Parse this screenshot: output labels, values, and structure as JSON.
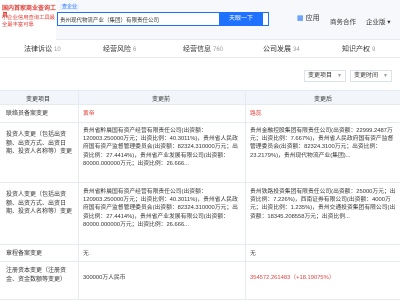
{
  "header": {
    "logo_line1": "国内首家商业查询工具",
    "logo_line2": "小企业信用查询工具最全最丰富可靠",
    "search_value": "贵州现代物流产业（集团）有限责任公司",
    "search_tag": "查企业",
    "search_button": "天眼一下",
    "vip_label": "应用",
    "nav_items": [
      "商务合作",
      "企业版"
    ]
  },
  "tabs": [
    {
      "label": "法律诉讼",
      "count": "10"
    },
    {
      "label": "经营风险",
      "count": "6"
    },
    {
      "label": "经营信息",
      "count": "760"
    },
    {
      "label": "公司发展",
      "count": "34"
    },
    {
      "label": "知识产权",
      "count": "9"
    }
  ],
  "filters": [
    "变更项目",
    "变更时间"
  ],
  "table": {
    "headers": [
      "变更项目",
      "变更前",
      "变更后"
    ],
    "rows": [
      {
        "item": "联络员备案变更",
        "before": "黄帝",
        "after": "路蕊",
        "before_red": true,
        "after_red": true
      },
      {
        "item": "投资人变更（包括出资额、出资方式、出资日期、投资人名称等）变更",
        "before": "贵州省黔晨国有资产经营有限责任公司(出资额：120903.250000万元；出资比例：40.3011%)，贵州省人民政府国有资产监督管理委员会(出资额：82324.310000万元；出资比例：27.4414%)，贵州省产业发展有限公司(出资额：80000.000000万元；出资比例：26.666...",
        "after": "贵州金融控股集团有限责任公司(出资额：22999.2487万元；出资比例：7.667%)，贵州省人民政府国有资产监督管理委员会(出资额：82324.3100万元；出资比例：23.2179%)，贵州现代物流产业(集团)..."
      },
      {
        "item": "投资人变更（包括出资额、出资方式、出资日期、投资人名称等）变更",
        "before": "贵州省黔晨国有资产经营有限责任公司(出资额：120903.250000万元；出资比例：40.3011%)，贵州省人民政府国有资产监督管理委员会(出资额：82324.310000万元；出资比例：27.4414%)，贵州省产业发展有限公司(出资额：80000.000000万元；出资比例：26.666...",
        "after": "贵州铁路投资集团有限责任公司(出资额：25000万元；出资比例：7.226%)，西南证券有限公司(出资额：4000万元；出资比例：1.235%)，贵州交通投资集团有限公司(出资额：18345.208558万元；出资比例..."
      },
      {
        "item": "章程备案变更",
        "before": "无",
        "after": "无"
      },
      {
        "item": "注册资本变更（注册资金、资金数额等变更）",
        "before": "300000万人民币",
        "after": "354572.261483（+18.19075%）",
        "after_red": true
      }
    ]
  }
}
